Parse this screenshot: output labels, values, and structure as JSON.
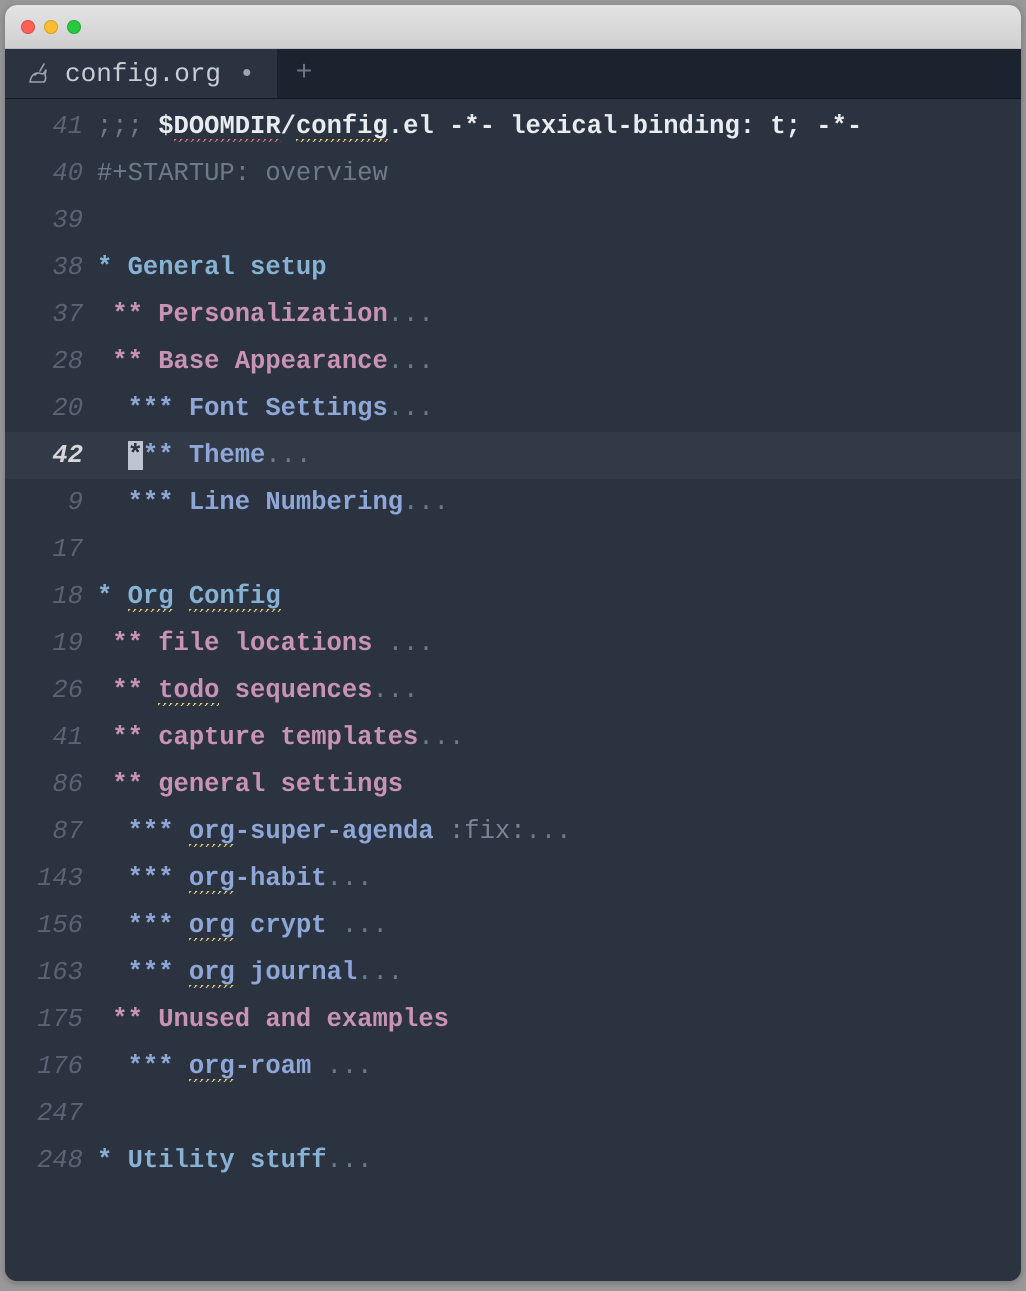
{
  "window": {
    "tab_title": "config.org",
    "modified_indicator": "•",
    "new_tab_label": "+"
  },
  "lines": [
    {
      "num": "41",
      "hl": false,
      "segs": [
        {
          "t": ";;; ",
          "c": "comment"
        },
        {
          "t": "$",
          "c": "bold"
        },
        {
          "t": "DOOMDIR",
          "c": "bold spell-r"
        },
        {
          "t": "/",
          "c": "bold"
        },
        {
          "t": "config",
          "c": "bold spell"
        },
        {
          "t": ".el -*- lexical-binding: t; -*-",
          "c": "bold"
        }
      ]
    },
    {
      "num": "40",
      "hl": false,
      "segs": [
        {
          "t": "#+STARTUP: overview",
          "c": "comment"
        }
      ]
    },
    {
      "num": "39",
      "hl": false,
      "segs": [
        {
          "t": " ",
          "c": ""
        }
      ]
    },
    {
      "num": "38",
      "hl": false,
      "segs": [
        {
          "t": "* General setup",
          "c": "h1"
        }
      ]
    },
    {
      "num": "37",
      "hl": false,
      "segs": [
        {
          "t": " ** Personalization",
          "c": "h2"
        },
        {
          "t": "...",
          "c": "dots"
        }
      ]
    },
    {
      "num": "28",
      "hl": false,
      "segs": [
        {
          "t": " ** Base Appearance",
          "c": "h2"
        },
        {
          "t": "...",
          "c": "dots"
        }
      ]
    },
    {
      "num": "20",
      "hl": false,
      "segs": [
        {
          "t": "  *** Font Settings",
          "c": "h3"
        },
        {
          "t": "...",
          "c": "dots"
        }
      ]
    },
    {
      "num": "42",
      "hl": true,
      "segs": [
        {
          "t": "  ",
          "c": "h3"
        },
        {
          "t": "*",
          "c": "cursor-block"
        },
        {
          "t": "** Theme",
          "c": "h3"
        },
        {
          "t": "...",
          "c": "dots"
        }
      ]
    },
    {
      "num": "9",
      "hl": false,
      "segs": [
        {
          "t": "  *** Line Numbering",
          "c": "h3"
        },
        {
          "t": "...",
          "c": "dots"
        }
      ]
    },
    {
      "num": "17",
      "hl": false,
      "segs": [
        {
          "t": " ",
          "c": ""
        }
      ]
    },
    {
      "num": "18",
      "hl": false,
      "segs": [
        {
          "t": "* ",
          "c": "h1"
        },
        {
          "t": "Org",
          "c": "h1 spell"
        },
        {
          "t": " ",
          "c": "h1"
        },
        {
          "t": "Config",
          "c": "h1 spell"
        }
      ]
    },
    {
      "num": "19",
      "hl": false,
      "segs": [
        {
          "t": " ** file locations ",
          "c": "h2"
        },
        {
          "t": "...",
          "c": "dots"
        }
      ]
    },
    {
      "num": "26",
      "hl": false,
      "segs": [
        {
          "t": " ** ",
          "c": "h2"
        },
        {
          "t": "todo",
          "c": "h2 spell"
        },
        {
          "t": " sequences",
          "c": "h2"
        },
        {
          "t": "...",
          "c": "dots"
        }
      ]
    },
    {
      "num": "41",
      "hl": false,
      "segs": [
        {
          "t": " ** capture templates",
          "c": "h2"
        },
        {
          "t": "...",
          "c": "dots"
        }
      ]
    },
    {
      "num": "86",
      "hl": false,
      "segs": [
        {
          "t": " ** general settings",
          "c": "h2"
        }
      ]
    },
    {
      "num": "87",
      "hl": false,
      "segs": [
        {
          "t": "  *** ",
          "c": "h3"
        },
        {
          "t": "org",
          "c": "h3 spell"
        },
        {
          "t": "-super-agenda ",
          "c": "h3"
        },
        {
          "t": ":fix:",
          "c": "tag"
        },
        {
          "t": "...",
          "c": "dots"
        }
      ]
    },
    {
      "num": "143",
      "hl": false,
      "segs": [
        {
          "t": "  *** ",
          "c": "h3"
        },
        {
          "t": "org",
          "c": "h3 spell"
        },
        {
          "t": "-habit",
          "c": "h3"
        },
        {
          "t": "...",
          "c": "dots"
        }
      ]
    },
    {
      "num": "156",
      "hl": false,
      "segs": [
        {
          "t": "  *** ",
          "c": "h3"
        },
        {
          "t": "org",
          "c": "h3 spell"
        },
        {
          "t": " crypt ",
          "c": "h3"
        },
        {
          "t": "...",
          "c": "dots"
        }
      ]
    },
    {
      "num": "163",
      "hl": false,
      "segs": [
        {
          "t": "  *** ",
          "c": "h3"
        },
        {
          "t": "org",
          "c": "h3 spell"
        },
        {
          "t": " journal",
          "c": "h3"
        },
        {
          "t": "...",
          "c": "dots"
        }
      ]
    },
    {
      "num": "175",
      "hl": false,
      "segs": [
        {
          "t": " ** Unused and examples",
          "c": "h2"
        }
      ]
    },
    {
      "num": "176",
      "hl": false,
      "segs": [
        {
          "t": "  *** ",
          "c": "h3"
        },
        {
          "t": "org",
          "c": "h3 spell"
        },
        {
          "t": "-roam ",
          "c": "h3"
        },
        {
          "t": "...",
          "c": "dots"
        }
      ]
    },
    {
      "num": "247",
      "hl": false,
      "segs": [
        {
          "t": " ",
          "c": ""
        }
      ]
    },
    {
      "num": "248",
      "hl": false,
      "segs": [
        {
          "t": "* Utility stuff",
          "c": "h1"
        },
        {
          "t": "...",
          "c": "dots"
        }
      ]
    }
  ]
}
